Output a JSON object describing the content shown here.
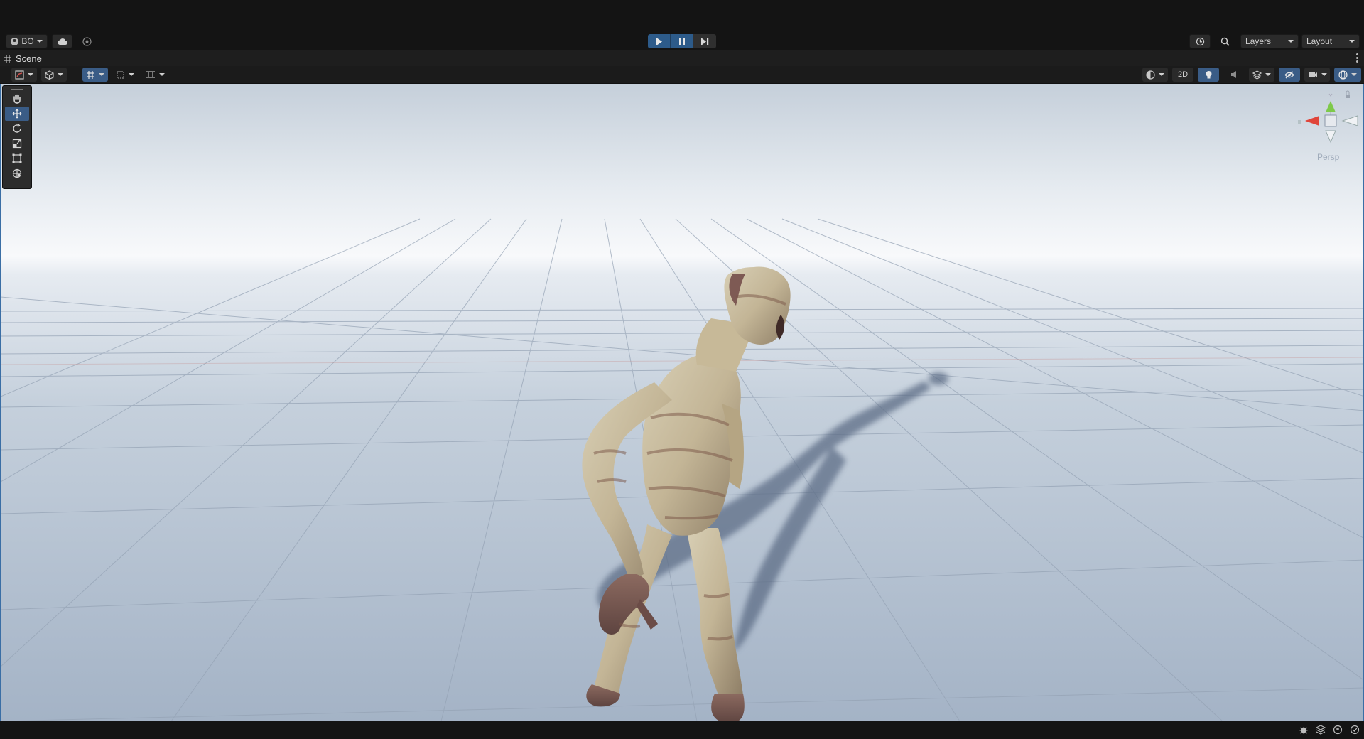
{
  "topbar": {
    "account_label": "BO",
    "layers_label": "Layers",
    "layout_label": "Layout"
  },
  "tab": {
    "title": "Scene"
  },
  "scene_toolbar": {
    "mode_2d_label": "2D"
  },
  "viewport": {
    "projection_label": "Persp",
    "sky_top": "#c9d3de",
    "horizon": "#f7f8fa",
    "ground": "#a7b6c9"
  },
  "colors": {
    "accent": "#3a5c86",
    "play_blue": "#2d5b8a",
    "viewport_border": "#3a6ea5"
  }
}
